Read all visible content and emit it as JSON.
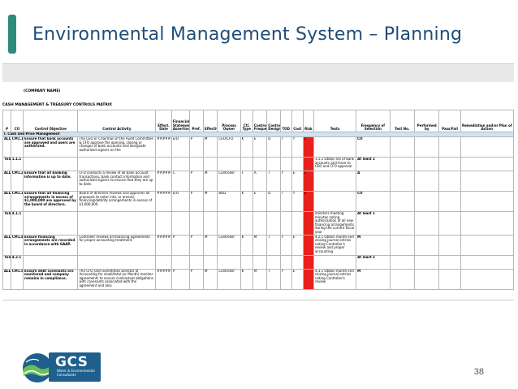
{
  "slide": {
    "title": "Environmental Management System – Planning",
    "page_number": "38"
  },
  "sheet": {
    "company_name": "(COMPANY NAME)",
    "matrix_title": "CASH MANAGEMENT & TREASURY CONTROLS MATRIX",
    "section_label": "I. Cash and Price Management",
    "headers": [
      "#",
      "Ctl",
      "Control Objective",
      "Control Activity",
      "Effect. Date",
      "Financial Statement Assertion",
      "Pref.",
      "Effective",
      "Process Owner",
      "Ctl. Type",
      "Control Frequency",
      "Control Design",
      "TOD",
      "Cost",
      "Risk",
      "Tests",
      "Frequency of Selection",
      "Test No.",
      "Performed by",
      "Pass/Fail",
      "Remediation and/or Plan of Action"
    ],
    "rows": [
      {
        "num": "ALL",
        "ctl": "CM1.1",
        "objective": "Ensure that bank accounts are approved and users are authorized.",
        "activity": "The CEO or Chairman of the Audit Committee & CFO approve the opening, closing or changes of bank accounts and designate authorized signers on the",
        "date": "######",
        "assert": "E/O",
        "pref": "P",
        "eff": "M",
        "owner": "CEO/CFO",
        "type": "K",
        "freq": "E",
        "design": "D",
        "tod": "T",
        "cost": "Y",
        "risk": "L",
        "tests": "",
        "frequency": "CO",
        "test_no": "",
        "by": "",
        "pf": "",
        "remediation": ""
      },
      {
        "num": "TEST",
        "ctl": "1.1.1",
        "objective": "",
        "activity": "",
        "date": "",
        "assert": "",
        "pref": "",
        "eff": "",
        "owner": "",
        "type": "",
        "freq": "",
        "design": "",
        "tod": "",
        "cost": "",
        "risk": "",
        "tests": "1.1.1 Obtain list of bank accounts and trace to CEO and CFO approval",
        "frequency": "At least 1",
        "test_no": "",
        "by": "",
        "pf": "",
        "remediation": ""
      },
      {
        "num": "ALL",
        "ctl": "CM1.2",
        "objective": "Ensure that all banking information is up to date.",
        "activity": "CFO conducts a review of all bank account transactions, bank contact information and authorized signers to ensure that they are up to date.",
        "date": "######",
        "assert": "C",
        "pref": "P",
        "eff": "M",
        "owner": "Controller",
        "type": "F",
        "freq": "A",
        "design": "T",
        "tod": "Y",
        "cost": "E",
        "risk": "L",
        "tests": "",
        "frequency": "A",
        "test_no": "",
        "by": "",
        "pf": "",
        "remediation": ""
      },
      {
        "num": "ALL",
        "ctl": "CM1.3",
        "objective": "Ensure that all financing arrangements in excess of $1,000,000 are approved by the board of directors.",
        "activity": "Board of directors reviews and approves all proposals to enter into, or amend, financing/debt/ity arrangements in excess of $1,000,000.",
        "date": "######",
        "assert": "E/O",
        "pref": "P",
        "eff": "M",
        "owner": "BOD",
        "type": "K",
        "freq": "E",
        "design": "D",
        "tod": "T",
        "cost": "Y",
        "risk": "E",
        "tests": "",
        "frequency": "CO",
        "test_no": "",
        "by": "",
        "pf": "",
        "remediation": ""
      },
      {
        "num": "TEST",
        "ctl": "4.1.1",
        "objective": "",
        "activity": "",
        "date": "",
        "assert": "",
        "pref": "",
        "eff": "",
        "owner": "",
        "type": "",
        "freq": "",
        "design": "",
        "tod": "",
        "cost": "",
        "risk": "",
        "tests": "directors meeting minutes noting authorization of all new financing arrangements during the current fiscal year",
        "frequency": "At least 1",
        "test_no": "",
        "by": "",
        "pf": "",
        "remediation": ""
      },
      {
        "num": "ALL",
        "ctl": "CM1.4",
        "objective": "Ensure financing arrangements are recorded in accordance with GAAP.",
        "activity": "Controller reviews all financing agreements for proper accounting treatment.",
        "date": "######",
        "assert": "P",
        "pref": "P",
        "eff": "M",
        "owner": "Controller",
        "type": "K",
        "freq": "M",
        "design": "T",
        "tod": "Y",
        "cost": "E",
        "risk": "",
        "tests": "4.2.1 Obtain month end closing journal entries noting Controller's review and proper accounting",
        "frequency": "M",
        "test_no": "",
        "by": "",
        "pf": "",
        "remediation": ""
      },
      {
        "num": "TEST",
        "ctl": "4.2.1",
        "objective": "",
        "activity": "",
        "date": "",
        "assert": "",
        "pref": "",
        "eff": "",
        "owner": "",
        "type": "",
        "freq": "",
        "design": "",
        "tod": "",
        "cost": "",
        "risk": "",
        "tests": "",
        "frequency": "At least 2",
        "test_no": "",
        "by": "",
        "pf": "",
        "remediation": ""
      },
      {
        "num": "ALL",
        "ctl": "CM1.5",
        "objective": "Ensure debt covenants are monitored and company remains in compliance.",
        "activity": "The CFO (and sometimes Director of Accounting for small/total (or Month) monitor agreements to ensure contractual obligations with covenants associated with the agreement and also",
        "date": "######",
        "assert": "P",
        "pref": "P",
        "eff": "M",
        "owner": "Controller",
        "type": "K",
        "freq": "M",
        "design": "T",
        "tod": "Y",
        "cost": "E",
        "risk": "",
        "tests": "4.3.1 Obtain month end closing journal entries noting Controller's review",
        "frequency": "M",
        "test_no": "",
        "by": "",
        "pf": "",
        "remediation": ""
      }
    ],
    "last_frequency": "At least 2"
  },
  "logo": {
    "name": "GCS",
    "subtitle_line1": "Water & Environmental",
    "subtitle_line2": "Consultants"
  },
  "colors": {
    "accent": "#2e8b7a",
    "title": "#1f4e79",
    "risk_flag": "#e8211c",
    "logo_blue": "#1e5f8c"
  }
}
